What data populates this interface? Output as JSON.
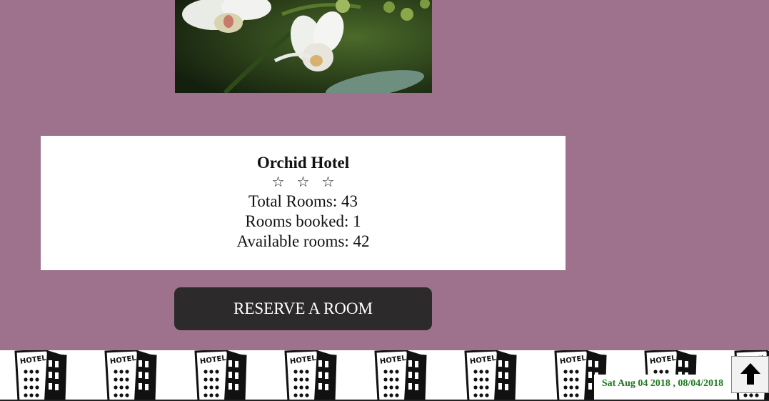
{
  "hotel": {
    "name": "Orchid Hotel",
    "stars_text": "☆ ☆ ☆",
    "total_rooms": "Total Rooms: 43",
    "rooms_booked": "Rooms booked: 1",
    "available_rooms": "Available rooms: 42"
  },
  "actions": {
    "reserve_label": "RESERVE A ROOM"
  },
  "footer": {
    "date_text": "Sat Aug 04 2018 , 08/04/2018",
    "tile_icon": "hotel-building-icon",
    "scroll_icon": "arrow-up-icon"
  },
  "colors": {
    "page_background": "#9e718c",
    "button_background": "#2d2a2b",
    "date_text": "#1d7a1d"
  }
}
